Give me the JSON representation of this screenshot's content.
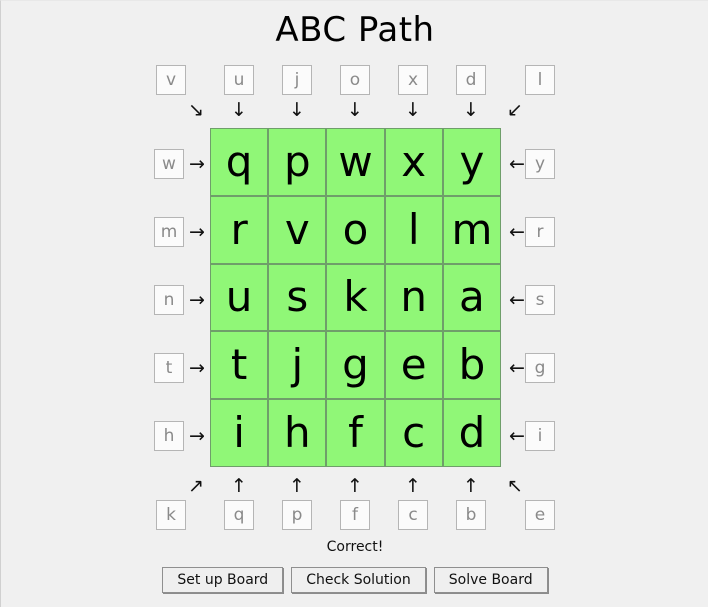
{
  "app": {
    "title": "ABC Path",
    "background": "#f0f0f0",
    "cell_color": "#90f777",
    "cell_border": "#6f9e6a",
    "clue_text_color": "#8a8a8a"
  },
  "grid": {
    "rows": 5,
    "cols": 5,
    "letters": [
      [
        "q",
        "p",
        "w",
        "x",
        "y"
      ],
      [
        "r",
        "v",
        "o",
        "l",
        "m"
      ],
      [
        "u",
        "s",
        "k",
        "n",
        "a"
      ],
      [
        "t",
        "j",
        "g",
        "e",
        "b"
      ],
      [
        "i",
        "h",
        "f",
        "c",
        "d"
      ]
    ]
  },
  "clues": {
    "top": [
      "u",
      "j",
      "o",
      "x",
      "d"
    ],
    "bottom": [
      "q",
      "p",
      "f",
      "c",
      "b"
    ],
    "left": [
      "w",
      "m",
      "n",
      "t",
      "h"
    ],
    "right": [
      "y",
      "r",
      "s",
      "g",
      "i"
    ],
    "corner_top_left": "v",
    "corner_top_right": "l",
    "corner_bottom_left": "k",
    "corner_bottom_right": "e"
  },
  "arrows": {
    "top": [
      "↓",
      "↓",
      "↓",
      "↓",
      "↓"
    ],
    "bottom": [
      "↑",
      "↑",
      "↑",
      "↑",
      "↑"
    ],
    "left": [
      "→",
      "→",
      "→",
      "→",
      "→"
    ],
    "right": [
      "←",
      "←",
      "←",
      "←",
      "←"
    ],
    "corner_top_left": "↘",
    "corner_top_right": "↙",
    "corner_bottom_left": "↗",
    "corner_bottom_right": "↖"
  },
  "status": {
    "text": "Correct!"
  },
  "buttons": [
    {
      "label": "Set up Board"
    },
    {
      "label": "Check Solution"
    },
    {
      "label": "Solve Board"
    }
  ]
}
